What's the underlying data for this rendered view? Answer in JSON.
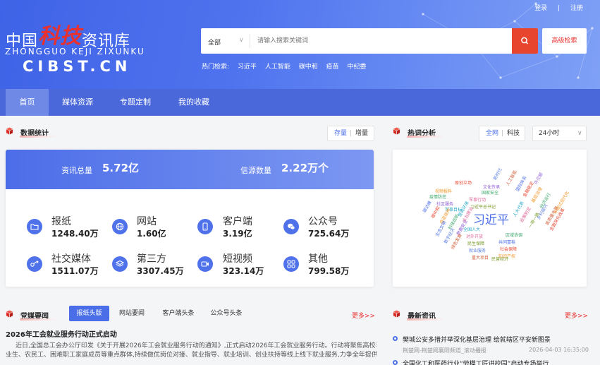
{
  "header": {
    "logo_prefix": "中国",
    "logo_red": "科技",
    "logo_suffix": "资讯库",
    "logo_pinyin": "ZHONGGUO KEJI ZIXUNKU",
    "logo_domain": "CIBST.CN",
    "login": "登录",
    "divider": "|",
    "register": "注册",
    "search_category": "全部",
    "search_placeholder": "请输入搜索关键词",
    "advanced_search": "高级检索",
    "hot_label": "热门检索:",
    "hot_terms": [
      "习近平",
      "人工智能",
      "碳中和",
      "疫苗",
      "中纪委"
    ]
  },
  "nav": {
    "items": [
      "首页",
      "媒体资源",
      "专题定制",
      "我的收藏"
    ],
    "active_index": 0
  },
  "stats": {
    "title": "数据统计",
    "toggle_left": "存量",
    "toggle_sep": "|",
    "toggle_right": "增量",
    "total_label": "资讯总量",
    "total_value": "5.72亿",
    "source_label": "信源数量",
    "source_value": "2.22万个",
    "items": [
      {
        "name": "报纸",
        "value": "1248.40万",
        "icon": "folder-icon"
      },
      {
        "name": "网站",
        "value": "1.60亿",
        "icon": "globe-icon"
      },
      {
        "name": "客户端",
        "value": "3.19亿",
        "icon": "phone-icon"
      },
      {
        "name": "公众号",
        "value": "725.64万",
        "icon": "wechat-icon"
      },
      {
        "name": "社交媒体",
        "value": "1511.07万",
        "icon": "share-icon"
      },
      {
        "name": "第三方",
        "value": "3307.45万",
        "icon": "layers-icon"
      },
      {
        "name": "短视频",
        "value": "323.14万",
        "icon": "video-icon"
      },
      {
        "name": "其他",
        "value": "799.58万",
        "icon": "grid-icon"
      }
    ]
  },
  "hotwords": {
    "title": "热词分析",
    "scope_all": "全网",
    "scope_sep": "|",
    "scope_tech": "科技",
    "period": "24小时",
    "words": [
      "习近平",
      "原创立场",
      "视频报料",
      "疫情防控",
      "社区服务",
      "军事目标",
      "军事行动",
      "习近平总书记",
      "新时代",
      "人工智能",
      "国际体系",
      "金融稳定",
      "基层治理",
      "经济运行",
      "外交部",
      "人大代表",
      "政策制定",
      "一带一路",
      "乡村振兴",
      "高质量发展",
      "碳达峰",
      "碳中和",
      "疫苗接种",
      "科技创新",
      "数据安全",
      "全国人大",
      "对外开放",
      "民生保障",
      "就业服务",
      "重大项目",
      "共同富裕",
      "社会保障",
      "知识产权",
      "国家安全",
      "文化传承",
      "营商环境",
      "法治建设",
      "民营经济",
      "数字经济",
      "绿色发展",
      "生态文明",
      "全面深化改革",
      "中国式现代化",
      "区域协调"
    ]
  },
  "party_media": {
    "title": "党媒要闻",
    "tabs": [
      "报纸头版",
      "网站要闻",
      "客户端头条",
      "公众号头条"
    ],
    "active_tab": 0,
    "more": "更多>>",
    "article_title": "2026年工会就业服务行动正式启动",
    "article_line1": "近日,全国总工会办公厅印发《关于开展2026年工会就业服务行动的通知》,正式启动2026年工会就业服务行动。行动将聚焦高校毕",
    "article_line2": "业生、农民工、困难职工家庭成员等重点群体,持续做优岗位对接、就业指导、就业培训、创业扶持等线上线下就业服务,力争全年提供..."
  },
  "latest": {
    "title": "最新资讯",
    "more": "更多>>",
    "items": [
      {
        "title": "樊城公安多措并举深化基层治理 绘就辖区平安新图景",
        "source": "荆楚网-荆楚网襄阳频道_滚动播报",
        "time": "2026-04-03 16:35:00"
      },
      {
        "title": "全国化工和医药行业“劳模工匠进校园”启动专场举行",
        "source": "",
        "time": ""
      }
    ]
  },
  "colors": {
    "accent": "#4a6ee8",
    "red": "#e8312f",
    "nav": "#4a68d9"
  }
}
